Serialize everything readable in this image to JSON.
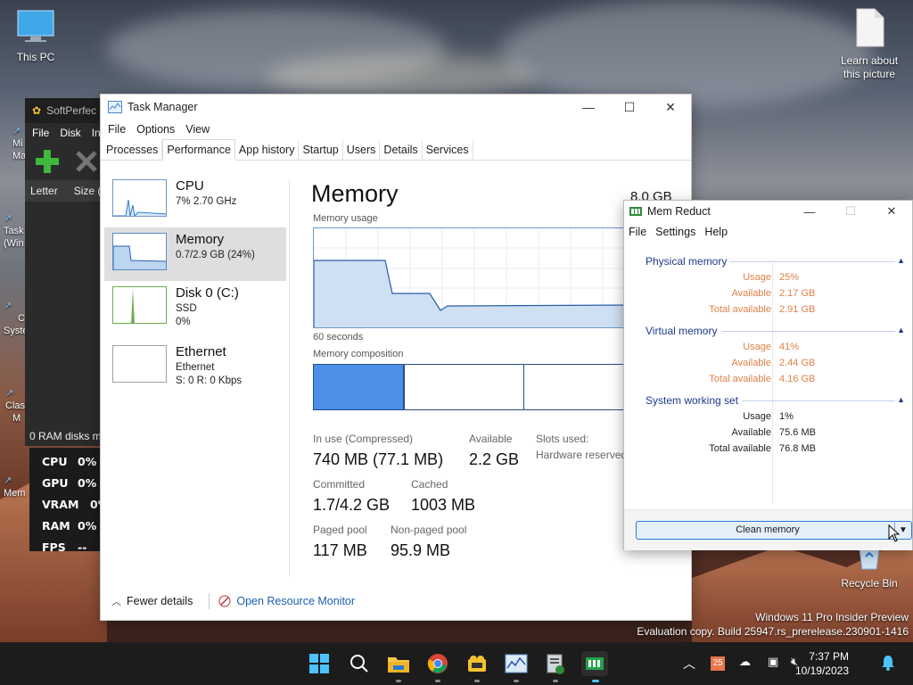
{
  "desktop": {
    "icons": [
      {
        "label": "This PC"
      },
      {
        "label": "Learn about this picture"
      },
      {
        "label": "Recycle Bin"
      }
    ],
    "partial_labels": [
      "Mi",
      "Ma",
      "Task",
      "(Win",
      "C",
      "Syste",
      "Clas",
      "M",
      "Mem"
    ],
    "watermark": {
      "line1": "Windows 11 Pro Insider Preview",
      "line2": "Evaluation copy. Build 25947.rs_prerelease.230901-1416"
    }
  },
  "softperfect": {
    "title": "SoftPerfec",
    "menu": [
      "File",
      "Disk",
      "In"
    ],
    "columns": [
      "Letter",
      "Size ("
    ],
    "status": "0 RAM disks m"
  },
  "osd": {
    "rows": [
      {
        "key": "CPU",
        "value": "0%"
      },
      {
        "key": "GPU",
        "value": "0%"
      },
      {
        "key": "VRAM",
        "value": "0%"
      },
      {
        "key": "RAM",
        "value": "0%"
      },
      {
        "key": "FPS",
        "value": "--"
      }
    ]
  },
  "task_manager": {
    "title": "Task Manager",
    "menu": [
      "File",
      "Options",
      "View"
    ],
    "tabs": [
      "Processes",
      "Performance",
      "App history",
      "Startup",
      "Users",
      "Details",
      "Services"
    ],
    "active_tab": "Performance",
    "sidebar": [
      {
        "name": "CPU",
        "line1": "7% 2.70 GHz",
        "line2": ""
      },
      {
        "name": "Memory",
        "line1": "0.7/2.9 GB (24%)",
        "line2": ""
      },
      {
        "name": "Disk 0 (C:)",
        "line1": "SSD",
        "line2": "0%"
      },
      {
        "name": "Ethernet",
        "line1": "Ethernet",
        "line2": "S: 0 R: 0 Kbps"
      }
    ],
    "panel": {
      "title": "Memory",
      "capacity": "8.0 GB",
      "usage_label": "Memory usage",
      "time_label": "60 seconds",
      "composition_label": "Memory composition",
      "stats": {
        "in_use_label": "In use (Compressed)",
        "in_use_value": "740 MB (77.1 MB)",
        "available_label": "Available",
        "available_value": "2.2 GB",
        "slots_label": "Slots used:",
        "hw_reserved_label": "Hardware reserved:",
        "committed_label": "Committed",
        "committed_value": "1.7/4.2 GB",
        "cached_label": "Cached",
        "cached_value": "1003 MB",
        "paged_label": "Paged pool",
        "paged_value": "117 MB",
        "nonpaged_label": "Non-paged pool",
        "nonpaged_value": "95.9 MB"
      }
    },
    "footer": {
      "fewer_details": "Fewer details",
      "resource_monitor": "Open Resource Monitor"
    }
  },
  "mem_reduct": {
    "title": "Mem Reduct",
    "menu": [
      "File",
      "Settings",
      "Help"
    ],
    "groups": [
      {
        "name": "Physical memory",
        "rows": [
          {
            "k": "Usage",
            "v": "25%"
          },
          {
            "k": "Available",
            "v": "2.17 GB"
          },
          {
            "k": "Total available",
            "v": "2.91 GB"
          }
        ]
      },
      {
        "name": "Virtual memory",
        "rows": [
          {
            "k": "Usage",
            "v": "41%"
          },
          {
            "k": "Available",
            "v": "2.44 GB"
          },
          {
            "k": "Total available",
            "v": "4.16 GB"
          }
        ]
      },
      {
        "name": "System working set",
        "rows": [
          {
            "k": "Usage",
            "v": "1%"
          },
          {
            "k": "Available",
            "v": "75.6 MB"
          },
          {
            "k": "Total available",
            "v": "76.8 MB"
          }
        ]
      }
    ],
    "clean_button": "Clean memory",
    "accent_orange": "#e0804a"
  },
  "taskbar": {
    "time": "7:37 PM",
    "date": "10/19/2023",
    "tray_badge": "25",
    "apps": [
      "start-icon",
      "search-icon",
      "file-explorer-icon",
      "chrome-icon",
      "softperfect-icon",
      "task-manager-icon",
      "mem-reduct-icon",
      "osd-app-icon"
    ]
  }
}
